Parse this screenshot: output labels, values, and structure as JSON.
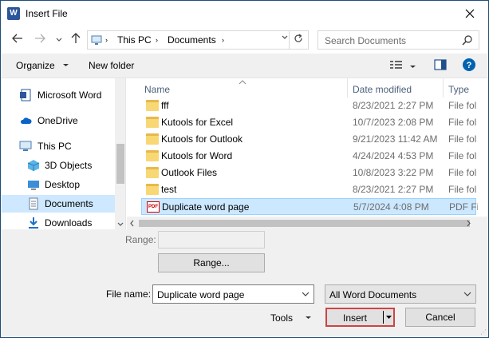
{
  "window": {
    "title": "Insert File",
    "app_icon": "W"
  },
  "address": {
    "crumbs": [
      "This PC",
      "Documents"
    ]
  },
  "search": {
    "placeholder": "Search Documents"
  },
  "toolbar": {
    "organize": "Organize",
    "new_folder": "New folder"
  },
  "nav": {
    "items": [
      {
        "label": "Microsoft Word",
        "icon": "word-doc-icon"
      },
      {
        "label": "OneDrive",
        "icon": "cloud-icon"
      },
      {
        "label": "This PC",
        "icon": "computer-icon"
      },
      {
        "label": "3D Objects",
        "icon": "cube-icon"
      },
      {
        "label": "Desktop",
        "icon": "desktop-icon"
      },
      {
        "label": "Documents",
        "icon": "documents-icon"
      },
      {
        "label": "Downloads",
        "icon": "download-icon"
      }
    ]
  },
  "list": {
    "columns": [
      "Name",
      "Date modified",
      "Type"
    ],
    "rows": [
      {
        "name": "fff",
        "date": "8/23/2021 2:27 PM",
        "type": "File fol",
        "icon": "folder-icon"
      },
      {
        "name": "Kutools for Excel",
        "date": "10/7/2023 2:08 PM",
        "type": "File fol",
        "icon": "folder-icon"
      },
      {
        "name": "Kutools for Outlook",
        "date": "9/21/2023 11:42 AM",
        "type": "File fol",
        "icon": "folder-icon"
      },
      {
        "name": "Kutools for Word",
        "date": "4/24/2024 4:53 PM",
        "type": "File fol",
        "icon": "folder-icon"
      },
      {
        "name": "Outlook Files",
        "date": "10/8/2023 3:22 PM",
        "type": "File fol",
        "icon": "folder-icon"
      },
      {
        "name": "test",
        "date": "8/23/2021 2:27 PM",
        "type": "File fol",
        "icon": "folder-icon"
      },
      {
        "name": "Duplicate word page",
        "date": "5/7/2024 4:08 PM",
        "type": "PDF Fi",
        "icon": "pdf-icon"
      }
    ],
    "pdf_icon_text": "PDF"
  },
  "bottom": {
    "range_label": "Range:",
    "range_button": "Range...",
    "file_name_label": "File name:",
    "file_name_value": "Duplicate word page",
    "file_type": "All Word Documents",
    "tools": "Tools",
    "insert": "Insert",
    "cancel": "Cancel"
  },
  "colors": {
    "accent": "#0078d7",
    "selection": "#cce8ff",
    "insert_border": "#cc4444"
  }
}
